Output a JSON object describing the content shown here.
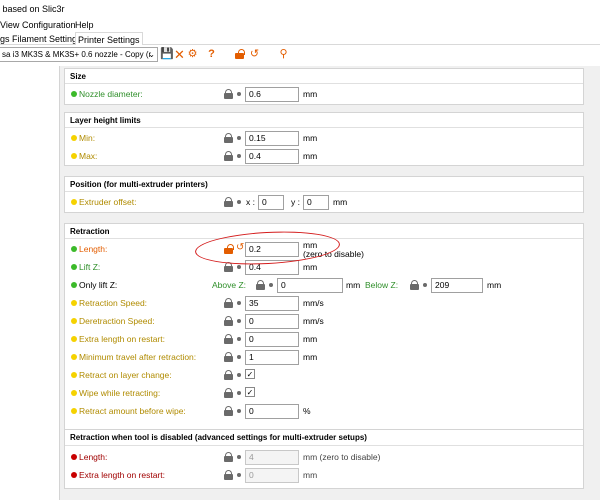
{
  "window": {
    "title": "l based on Slic3r"
  },
  "menu": [
    "View",
    "Configuration",
    "Help"
  ],
  "tabs": {
    "t0": "gs",
    "t1": "Filament Settings",
    "t2": "Printer Settings"
  },
  "toolbar": {
    "preset": "sa i3 MK3S & MK3S+ 0.6 nozzle - Copy (r"
  },
  "colors": {
    "green": "#3cba2a",
    "yellow": "#f5d200",
    "red": "#c80000",
    "annotation": "#d41b1b",
    "modified": "#e35d00"
  },
  "groups": {
    "size": {
      "title": "Size",
      "nozzle": {
        "label": "Nozzle diameter:",
        "value": "0.6",
        "unit": "mm"
      }
    },
    "layer": {
      "title": "Layer height limits",
      "min": {
        "label": "Min:",
        "value": "0.15",
        "unit": "mm"
      },
      "max": {
        "label": "Max:",
        "value": "0.4",
        "unit": "mm"
      }
    },
    "position": {
      "title": "Position (for multi-extruder printers)",
      "offset": {
        "label": "Extruder offset:",
        "x_label": "x :",
        "x": "0",
        "y_label": "y :",
        "y": "0",
        "unit": "mm"
      }
    },
    "retraction": {
      "title": "Retraction",
      "length": {
        "label": "Length:",
        "value": "0.2",
        "unit": "mm",
        "hint": "(zero to disable)"
      },
      "liftz": {
        "label": "Lift Z:",
        "value": "0.4",
        "unit": "mm"
      },
      "onlylift": {
        "label": "Only lift Z:",
        "above_label": "Above Z:",
        "above": "0",
        "above_unit": "mm",
        "below_label": "Below Z:",
        "below": "209",
        "below_unit": "mm"
      },
      "speed": {
        "label": "Retraction Speed:",
        "value": "35",
        "unit": "mm/s"
      },
      "despeed": {
        "label": "Deretraction Speed:",
        "value": "0",
        "unit": "mm/s"
      },
      "extra": {
        "label": "Extra length on restart:",
        "value": "0",
        "unit": "mm"
      },
      "mintravel": {
        "label": "Minimum travel after retraction:",
        "value": "1",
        "unit": "mm"
      },
      "layerchange": {
        "label": "Retract on layer change:",
        "check": "✓"
      },
      "wipe": {
        "label": "Wipe while retracting:",
        "check": "✓"
      },
      "beforewipe": {
        "label": "Retract amount before wipe:",
        "value": "0",
        "unit": "%"
      }
    },
    "toolchange": {
      "title": "Retraction when tool is disabled (advanced settings for multi-extruder setups)",
      "length": {
        "label": "Length:",
        "value": "4",
        "unit": "mm (zero to disable)"
      },
      "extra": {
        "label": "Extra length on restart:",
        "value": "0",
        "unit": "mm"
      }
    }
  }
}
